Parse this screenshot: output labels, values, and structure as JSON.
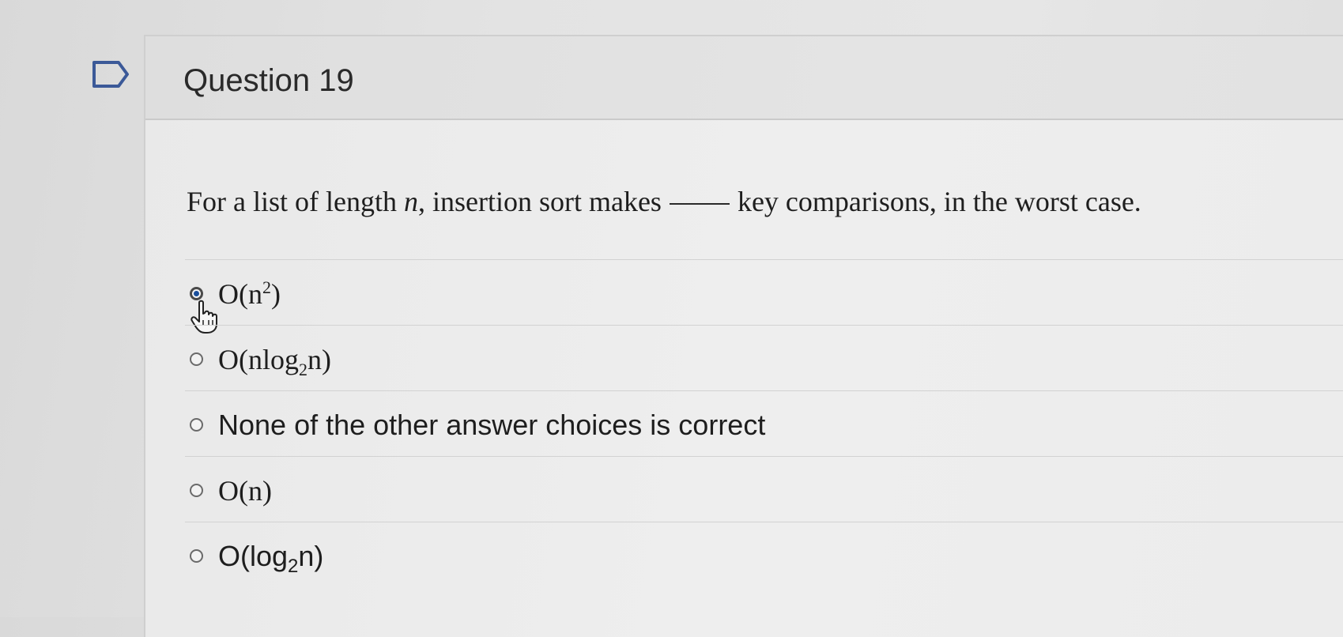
{
  "question": {
    "title": "Question 19",
    "text_before": "For a list of length ",
    "var": "n",
    "text_middle": ", insertion sort makes",
    "text_after": "key comparisons, in the worst case."
  },
  "answers": [
    {
      "base": "O(n",
      "sup": "2",
      "tail": ")",
      "selected": true
    },
    {
      "base": "O(nlog",
      "sub": "2",
      "tail": "n)",
      "selected": false
    },
    {
      "text": "None of the other answer choices is correct",
      "selected": false
    },
    {
      "text": "O(n)",
      "selected": false
    },
    {
      "base": "O(log",
      "sub": "2",
      "tail": "n)",
      "selected": false
    }
  ],
  "icons": {
    "flag": "flag-icon",
    "cursor": "hand-pointer-icon"
  },
  "colors": {
    "radio_selected": "#1a4f9c"
  }
}
